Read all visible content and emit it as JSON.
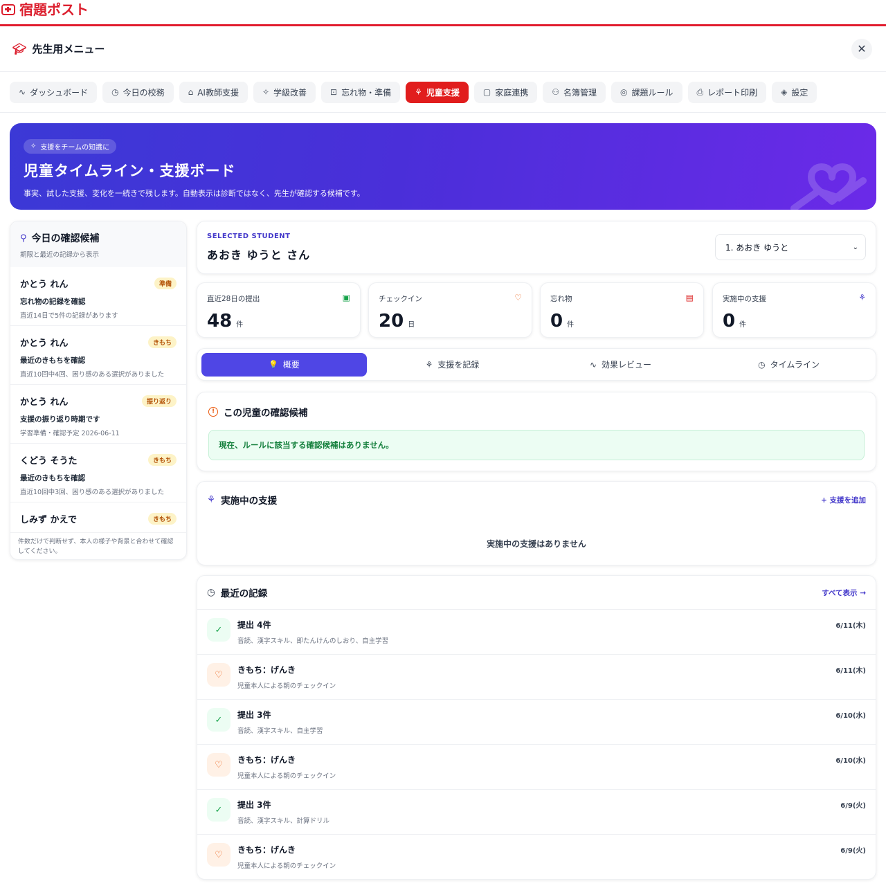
{
  "app": {
    "brand": "宿題ポスト"
  },
  "menu": {
    "title": "先生用メニュー",
    "close": "✕"
  },
  "nav": [
    {
      "label": "ダッシュボード",
      "icon": "∿"
    },
    {
      "label": "今日の校務",
      "icon": "◷"
    },
    {
      "label": "AI教師支援",
      "icon": "⌂"
    },
    {
      "label": "学級改善",
      "icon": "✧"
    },
    {
      "label": "忘れ物・準備",
      "icon": "⊡"
    },
    {
      "label": "児童支援",
      "icon": "⚘"
    },
    {
      "label": "家庭連携",
      "icon": "▢"
    },
    {
      "label": "名簿管理",
      "icon": "⚇"
    },
    {
      "label": "課題ルール",
      "icon": "◎"
    },
    {
      "label": "レポート印刷",
      "icon": "⎙"
    },
    {
      "label": "設定",
      "icon": "◈"
    }
  ],
  "hero": {
    "badge": "支援をチームの知識に",
    "title": "児童タイムライン・支援ボード",
    "subtitle": "事実、試した支援、変化を一続きで残します。自動表示は診断ではなく、先生が確認する候補です。"
  },
  "candidates": {
    "title": "今日の確認候補",
    "subtitle": "期限と最近の記録から表示",
    "items": [
      {
        "name": "かとう れん",
        "tag": "準備",
        "reason": "忘れ物の記録を確認",
        "detail": "直近14日で5件の記録があります"
      },
      {
        "name": "かとう れん",
        "tag": "きもち",
        "reason": "最近のきもちを確認",
        "detail": "直近10回中4回、困り感のある選択がありました"
      },
      {
        "name": "かとう れん",
        "tag": "振り返り",
        "reason": "支援の振り返り時期です",
        "detail": "学習準備・確認予定 2026-06-11"
      },
      {
        "name": "くどう そうた",
        "tag": "きもち",
        "reason": "最近のきもちを確認",
        "detail": "直近10回中3回、困り感のある選択がありました"
      },
      {
        "name": "しみず かえで",
        "tag": "きもち",
        "reason": "",
        "detail": ""
      }
    ],
    "note": "件数だけで判断せず、本人の様子や背景と合わせて確認してください。"
  },
  "student": {
    "label": "SELECTED STUDENT",
    "name": "あおき ゆうと さん",
    "select_value": "1. あおき ゆうと"
  },
  "stats": [
    {
      "label": "直近28日の提出",
      "value": "48",
      "unit": "件",
      "icon": "▣",
      "color": "#16a34a"
    },
    {
      "label": "チェックイン",
      "value": "20",
      "unit": "日",
      "icon": "♡",
      "color": "#ea580c"
    },
    {
      "label": "忘れ物",
      "value": "0",
      "unit": "件",
      "icon": "▤",
      "color": "#dc2626"
    },
    {
      "label": "実施中の支援",
      "value": "0",
      "unit": "件",
      "icon": "⚘",
      "color": "#4338ca"
    }
  ],
  "tabs": [
    {
      "label": "概要",
      "icon": "💡"
    },
    {
      "label": "支援を記録",
      "icon": "⚘"
    },
    {
      "label": "効果レビュー",
      "icon": "∿"
    },
    {
      "label": "タイムライン",
      "icon": "◷"
    }
  ],
  "check": {
    "title": "この児童の確認候補",
    "icon": "!",
    "message": "現在、ルールに該当する確認候補はありません。"
  },
  "support": {
    "title": "実施中の支援",
    "add": "+ 支援を追加",
    "empty": "実施中の支援はありません"
  },
  "recent": {
    "title": "最近の記録",
    "all": "すべて表示 →",
    "items": [
      {
        "kind": "sub",
        "title": "提出 4件",
        "detail": "音読、漢字スキル、即たんけんのしおり、自主学習",
        "date": "6/11(木)"
      },
      {
        "kind": "mood",
        "title": "きもち：げんき",
        "detail": "児童本人による朝のチェックイン",
        "date": "6/11(木)"
      },
      {
        "kind": "sub",
        "title": "提出 3件",
        "detail": "音読、漢字スキル、自主学習",
        "date": "6/10(水)"
      },
      {
        "kind": "mood",
        "title": "きもち：げんき",
        "detail": "児童本人による朝のチェックイン",
        "date": "6/10(水)"
      },
      {
        "kind": "sub",
        "title": "提出 3件",
        "detail": "音読、漢字スキル、計算ドリル",
        "date": "6/9(火)"
      },
      {
        "kind": "mood",
        "title": "きもち：げんき",
        "detail": "児童本人による朝のチェックイン",
        "date": "6/9(火)"
      }
    ]
  }
}
